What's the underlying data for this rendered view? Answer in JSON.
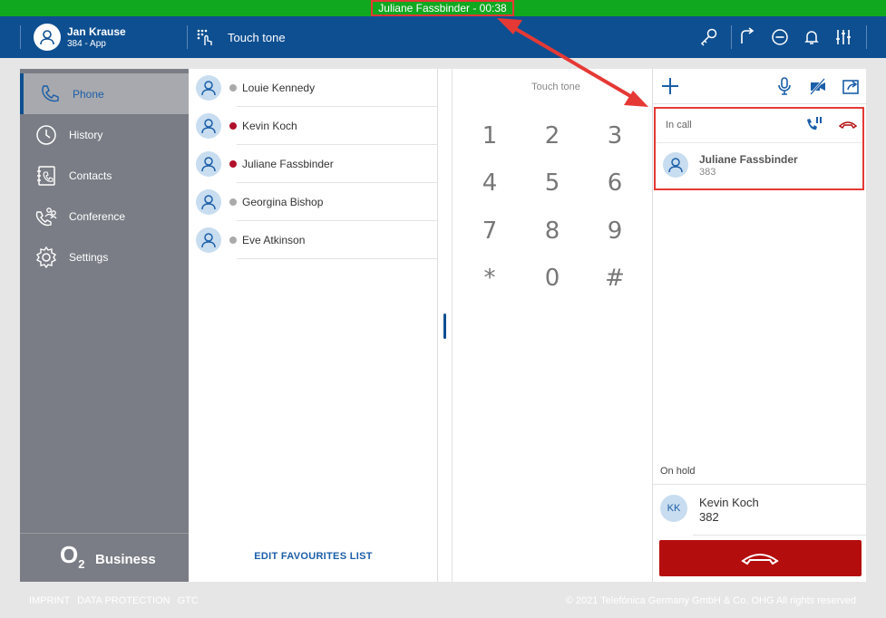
{
  "callbar": {
    "label": "Juliane Fassbinder - 00:38",
    "color": "#10a81f"
  },
  "header": {
    "user_name": "Jan Krause",
    "user_sub": "384 - App",
    "touch_tone_label": "Touch tone",
    "icons": [
      "key-icon",
      "call-forward-icon",
      "do-not-disturb-icon",
      "bell-icon",
      "equalizer-icon"
    ],
    "color": "#0e4f91"
  },
  "sidebar": {
    "items": [
      {
        "label": "Phone",
        "icon": "phone-icon",
        "active": true
      },
      {
        "label": "History",
        "icon": "clock-icon"
      },
      {
        "label": "Contacts",
        "icon": "contacts-icon"
      },
      {
        "label": "Conference",
        "icon": "conference-icon"
      },
      {
        "label": "Settings",
        "icon": "gear-icon"
      }
    ],
    "brand_o2": "O",
    "brand_o2_sub": "2",
    "brand_business": "Business"
  },
  "favourites": {
    "items": [
      {
        "name": "Louie Kennedy",
        "status": "#aaaaaa"
      },
      {
        "name": "Kevin Koch",
        "status": "#b0102a"
      },
      {
        "name": "Juliane Fassbinder",
        "status": "#b0102a"
      },
      {
        "name": "Georgina Bishop",
        "status": "#aaaaaa"
      },
      {
        "name": "Eve Atkinson",
        "status": "#aaaaaa"
      }
    ],
    "edit_label": "EDIT FAVOURITES LIST"
  },
  "dialpad": {
    "title": "Touch tone",
    "keys": [
      "1",
      "2",
      "3",
      "4",
      "5",
      "6",
      "7",
      "8",
      "9",
      "*",
      "0",
      "#"
    ]
  },
  "call_panel": {
    "in_call_label": "In call",
    "active_call": {
      "name": "Juliane Fassbinder",
      "number": "383"
    },
    "on_hold_label": "On hold",
    "held_call": {
      "initials": "KK",
      "name": "Kevin Koch",
      "number": "382"
    }
  },
  "footer": {
    "links": [
      "IMPRINT",
      "DATA PROTECTION",
      "GTC"
    ],
    "copyright": "© 2021 Telefónica Germany GmbH & Co. OHG All rights reserved"
  }
}
